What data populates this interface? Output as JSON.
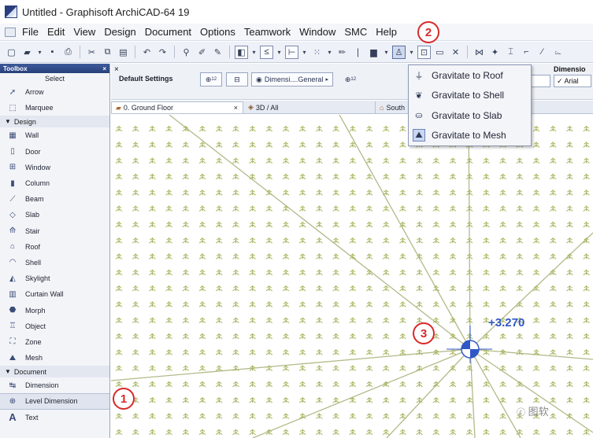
{
  "window": {
    "title": "Untitled - Graphisoft ArchiCAD-64 19"
  },
  "menu": [
    "File",
    "Edit",
    "View",
    "Design",
    "Document",
    "Options",
    "Teamwork",
    "Window",
    "SMC",
    "Help"
  ],
  "toolbox": {
    "title": "Toolbox",
    "close": "×",
    "select_label": "Select",
    "items_top": [
      {
        "label": "Arrow",
        "icon": "arrow-icon"
      },
      {
        "label": "Marquee",
        "icon": "marquee-icon"
      }
    ],
    "section_design": "Design",
    "design_items": [
      {
        "label": "Wall",
        "icon": "wall-icon"
      },
      {
        "label": "Door",
        "icon": "door-icon"
      },
      {
        "label": "Window",
        "icon": "window-icon"
      },
      {
        "label": "Column",
        "icon": "column-icon"
      },
      {
        "label": "Beam",
        "icon": "beam-icon"
      },
      {
        "label": "Slab",
        "icon": "slab-icon"
      },
      {
        "label": "Stair",
        "icon": "stair-icon"
      },
      {
        "label": "Roof",
        "icon": "roof-icon"
      },
      {
        "label": "Shell",
        "icon": "shell-icon"
      },
      {
        "label": "Skylight",
        "icon": "skylight-icon"
      },
      {
        "label": "Curtain Wall",
        "icon": "curtain-wall-icon"
      },
      {
        "label": "Morph",
        "icon": "morph-icon"
      },
      {
        "label": "Object",
        "icon": "object-icon"
      },
      {
        "label": "Zone",
        "icon": "zone-icon"
      },
      {
        "label": "Mesh",
        "icon": "mesh-icon"
      }
    ],
    "section_document": "Document",
    "document_items": [
      {
        "label": "Dimension",
        "icon": "dimension-icon"
      },
      {
        "label": "Level Dimension",
        "icon": "level-dimension-icon",
        "selected": true
      },
      {
        "label": "Text",
        "icon": "text-icon"
      }
    ]
  },
  "infobox": {
    "close": "×",
    "default_settings": "Default Settings",
    "dimension_button": "Dimensi....General",
    "dimension_label": "Dimensio",
    "font_value": "✓ Arial",
    "superscript_a": "12",
    "superscript_b": "12"
  },
  "tabs": [
    {
      "label": "0. Ground Floor",
      "close": "×",
      "icon": "floor-plan-icon"
    },
    {
      "label": "3D / All",
      "icon": "3d-icon"
    },
    {
      "label": "South",
      "icon": "elevation-icon"
    }
  ],
  "gravitate_menu": {
    "items": [
      {
        "label": "Gravitate to Roof",
        "icon": "gravitate-roof-icon"
      },
      {
        "label": "Gravitate to Shell",
        "icon": "gravitate-shell-icon"
      },
      {
        "label": "Gravitate to Slab",
        "icon": "gravitate-slab-icon"
      },
      {
        "label": "Gravitate to Mesh",
        "icon": "gravitate-mesh-icon",
        "checked": true
      }
    ]
  },
  "canvas": {
    "elevation_value": "+3.270",
    "watermark": "图软"
  },
  "callouts": [
    "1",
    "2",
    "3"
  ],
  "colors": {
    "callout_red": "#d9292b",
    "grid_symbol": "#a7b35c",
    "mesh_line": "#b5b989",
    "elevation_blue": "#3057c7"
  }
}
